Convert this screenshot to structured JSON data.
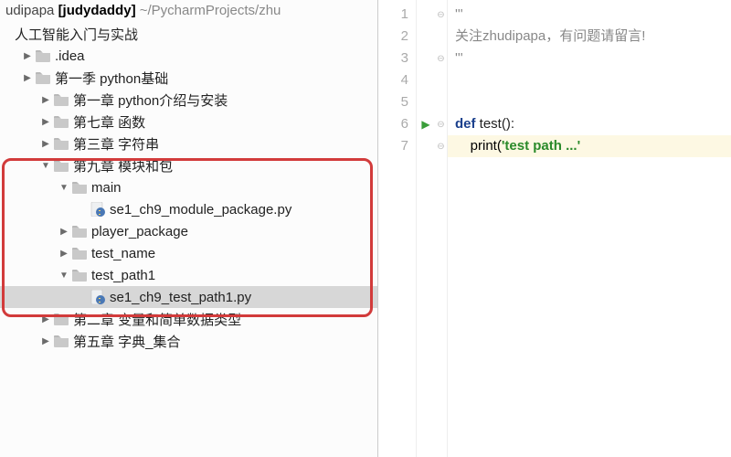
{
  "breadcrumb": {
    "prefix": "udipapa",
    "project": "[judydaddy]",
    "path": "~/PycharmProjects/zhu"
  },
  "tree": {
    "root": "人工智能入门与实战",
    "items": [
      {
        "indent": 1,
        "arrow": "▶",
        "type": "folder",
        "label": ".idea"
      },
      {
        "indent": 1,
        "arrow": "▶",
        "type": "folder",
        "label": "第一季 python基础"
      },
      {
        "indent": 2,
        "arrow": "▶",
        "type": "folder",
        "label": "第一章 python介绍与安装"
      },
      {
        "indent": 2,
        "arrow": "▶",
        "type": "folder",
        "label": "第七章 函数"
      },
      {
        "indent": 2,
        "arrow": "▶",
        "type": "folder",
        "label": "第三章 字符串"
      },
      {
        "indent": 2,
        "arrow": "▼",
        "type": "folder",
        "label": "第九章 模块和包"
      },
      {
        "indent": 3,
        "arrow": "▼",
        "type": "folder",
        "label": "main"
      },
      {
        "indent": 4,
        "arrow": "",
        "type": "py",
        "label": "se1_ch9_module_package.py"
      },
      {
        "indent": 3,
        "arrow": "▶",
        "type": "folder",
        "label": "player_package"
      },
      {
        "indent": 3,
        "arrow": "▶",
        "type": "folder",
        "label": "test_name"
      },
      {
        "indent": 3,
        "arrow": "▼",
        "type": "folder",
        "label": "test_path1"
      },
      {
        "indent": 4,
        "arrow": "",
        "type": "py",
        "label": "se1_ch9_test_path1.py",
        "selected": true
      },
      {
        "indent": 2,
        "arrow": "▶",
        "type": "folder",
        "label": "第二章 变量和简单数据类型"
      },
      {
        "indent": 2,
        "arrow": "▶",
        "type": "folder",
        "label": "第五章 字典_集合"
      }
    ]
  },
  "editor": {
    "lines": [
      {
        "n": 1,
        "fold": "⊖",
        "tokens": [
          [
            "cmt",
            "'''"
          ]
        ]
      },
      {
        "n": 2,
        "tokens": [
          [
            "cmt",
            "关注zhudipapa，有问题请留言!"
          ]
        ]
      },
      {
        "n": 3,
        "fold": "⊖",
        "tokens": [
          [
            "cmt",
            "'''"
          ]
        ]
      },
      {
        "n": 4,
        "tokens": []
      },
      {
        "n": 5,
        "tokens": []
      },
      {
        "n": 6,
        "run": true,
        "fold": "⊖",
        "tokens": [
          [
            "kw",
            "def "
          ],
          [
            "fn",
            "test():"
          ]
        ]
      },
      {
        "n": 7,
        "hl": true,
        "fold": "⊖",
        "tokens": [
          [
            "pl",
            "    print("
          ],
          [
            "str",
            "'test path ...'"
          ]
        ]
      }
    ]
  }
}
